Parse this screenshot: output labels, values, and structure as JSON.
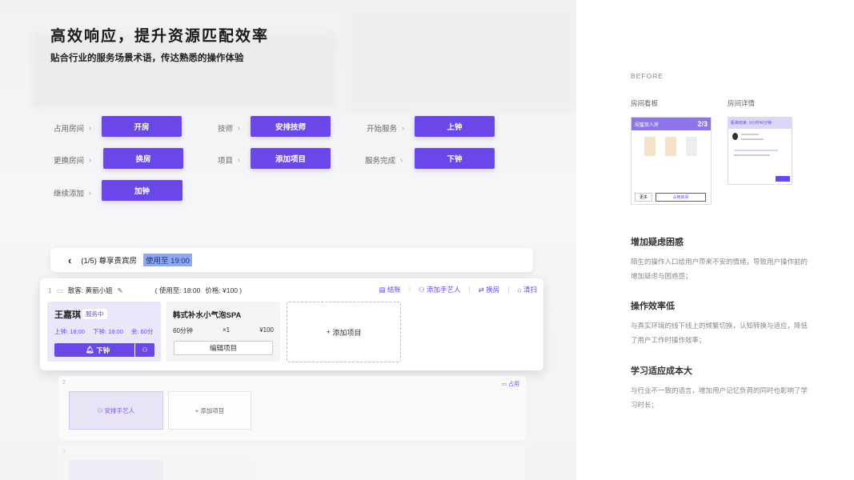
{
  "header": {
    "title": "高效响应，提升资源匹配效率",
    "subtitle": "贴合行业的服务场景术语，传达熟悉的操作体验"
  },
  "actions": [
    {
      "label": "占用房间",
      "button": "开房"
    },
    {
      "label": "技师",
      "button": "安排技师"
    },
    {
      "label": "开始服务",
      "button": "上钟"
    },
    {
      "label": "更换房间",
      "button": "换房"
    },
    {
      "label": "项目",
      "button": "添加项目"
    },
    {
      "label": "服务完成",
      "button": "下钟"
    },
    {
      "label": "继续添加",
      "button": "加钟"
    }
  ],
  "room_bar": {
    "back": "‹",
    "title": "(1/5) 尊享贵宾房",
    "usage": "使用至 19:00"
  },
  "guest_card": {
    "num": "1",
    "guest": "散客: 黄丽小姐",
    "usage": "( 使用至: 18:00",
    "price": "价格: ¥100 )",
    "acts": [
      "结账",
      "添加手艺人",
      "换房",
      "清扫"
    ],
    "tech": {
      "name": "王嘉琪",
      "status": "服务中",
      "start": "上钟: 18:00",
      "end": "下钟: 18:00",
      "left": "余: 60分",
      "end_button": "下钟"
    },
    "service": {
      "name": "韩式补水小气泡SPA",
      "duration": "60分钟",
      "qty": "×1",
      "price": "¥100",
      "edit": "编辑项目"
    },
    "add": "添加项目"
  },
  "card2": {
    "num": "2",
    "use": "占用",
    "assign": "安排手艺人",
    "add": "添加项目"
  },
  "card3": {
    "num": "3"
  },
  "right": {
    "before": "BEFORE",
    "thumb1": "房间看板",
    "thumb2": "房间详情",
    "board_title": "闺蜜双人房",
    "board_count": "2/3",
    "more": "更多",
    "occupy": "占用房间",
    "detail_title": "距离结束: 3小时40分钟",
    "s1": {
      "title": "增加疑虑困惑",
      "text": "陌生的操作入口给用户带来不安的情绪，导致用户操作前的增加疑虑与困惑感；"
    },
    "s2": {
      "title": "操作效率低",
      "text": "与真实环境的线下线上的频繁切换，认知转换与适应，降低了用户工作时操作效率；"
    },
    "s3": {
      "title": "学习适应成本大",
      "text": "与行业不一致的语言，增加用户记忆负荷的同时也影响了学习时长；"
    }
  }
}
